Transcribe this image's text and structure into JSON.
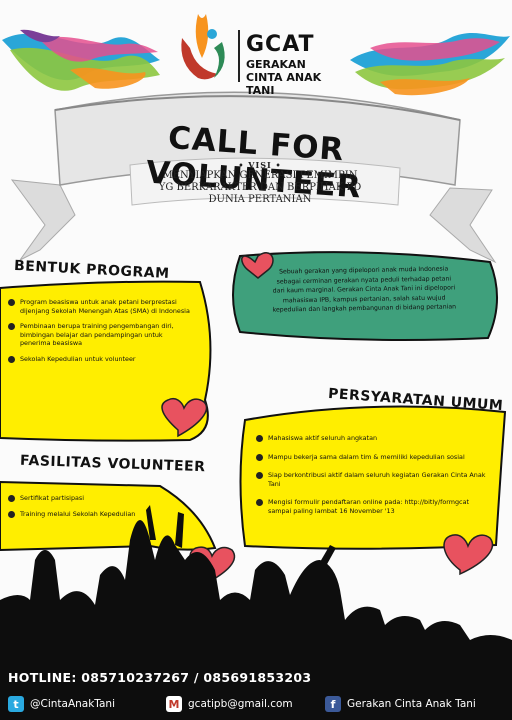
{
  "logo": {
    "abbr": "GCAT",
    "line1": "GERAKAN",
    "line2": "CINTA ANAK TANI"
  },
  "headline": "CALL FOR VOLUNTEER",
  "visi": {
    "label": "• VISI •",
    "lines": [
      "MENYIAPKAN GENERASI PEMIMPIN",
      "YG BERKARAKTER DAN BERPIHAK PD",
      "DUNIA PERTANIAN"
    ]
  },
  "about": [
    "Sebuah gerakan yang dipelopori anak muda Indonesia",
    "sebagai cerminan gerakan nyata peduli terhadap petani",
    "dari kaum marginal. Gerakan Cinta Anak Tani ini dipelopori",
    "mahasiswa IPB, kampus pertanian, salah satu wujud",
    "kepedulian dan langkah pembangunan di bidang pertanian"
  ],
  "bentuk_program": {
    "title": "BENTUK PROGRAM",
    "items": [
      "Program beasiswa untuk anak petani berprestasi dijenjang Sekolah Menengah Atas (SMA) di Indonesia",
      "Pembinaan berupa training pengembangan diri, bimbingan belajar dan pendampingan untuk penerima beasiswa",
      "Sekolah Kepedulian untuk volunteer"
    ]
  },
  "fasilitas": {
    "title": "FASILITAS VOLUNTEER",
    "items": [
      "Sertifikat partisipasi",
      "Training melalui Sekolah Kepedulian"
    ]
  },
  "persyaratan": {
    "title": "PERSYARATAN UMUM",
    "items": [
      "Mahasiswa aktif seluruh angkatan",
      "Mampu bekerja sama dalam tim & memiliki kepedulian sosial",
      "Siap berkontribusi aktif dalam seluruh kegiatan Gerakan Cinta Anak Tani",
      "Mengisi formulir pendaftaran online pada: http://bitly/formgcat sampai paling lambat 16 November '13"
    ]
  },
  "footer": {
    "hotline": "HOTLINE: 085710237267 / 085691853203",
    "twitter": "@CintaAnakTani",
    "email": "gcatipb@gmail.com",
    "facebook": "Gerakan Cinta Anak Tani"
  },
  "icons": {
    "twitter": "twitter-icon",
    "email": "gmail-icon",
    "facebook": "facebook-icon"
  },
  "colors": {
    "yellow": "#ffee00",
    "green": "#3fa07c",
    "heart": "#e8525f",
    "ribbon": "#d9d9d9",
    "silhouette": "#0d0d0d"
  }
}
